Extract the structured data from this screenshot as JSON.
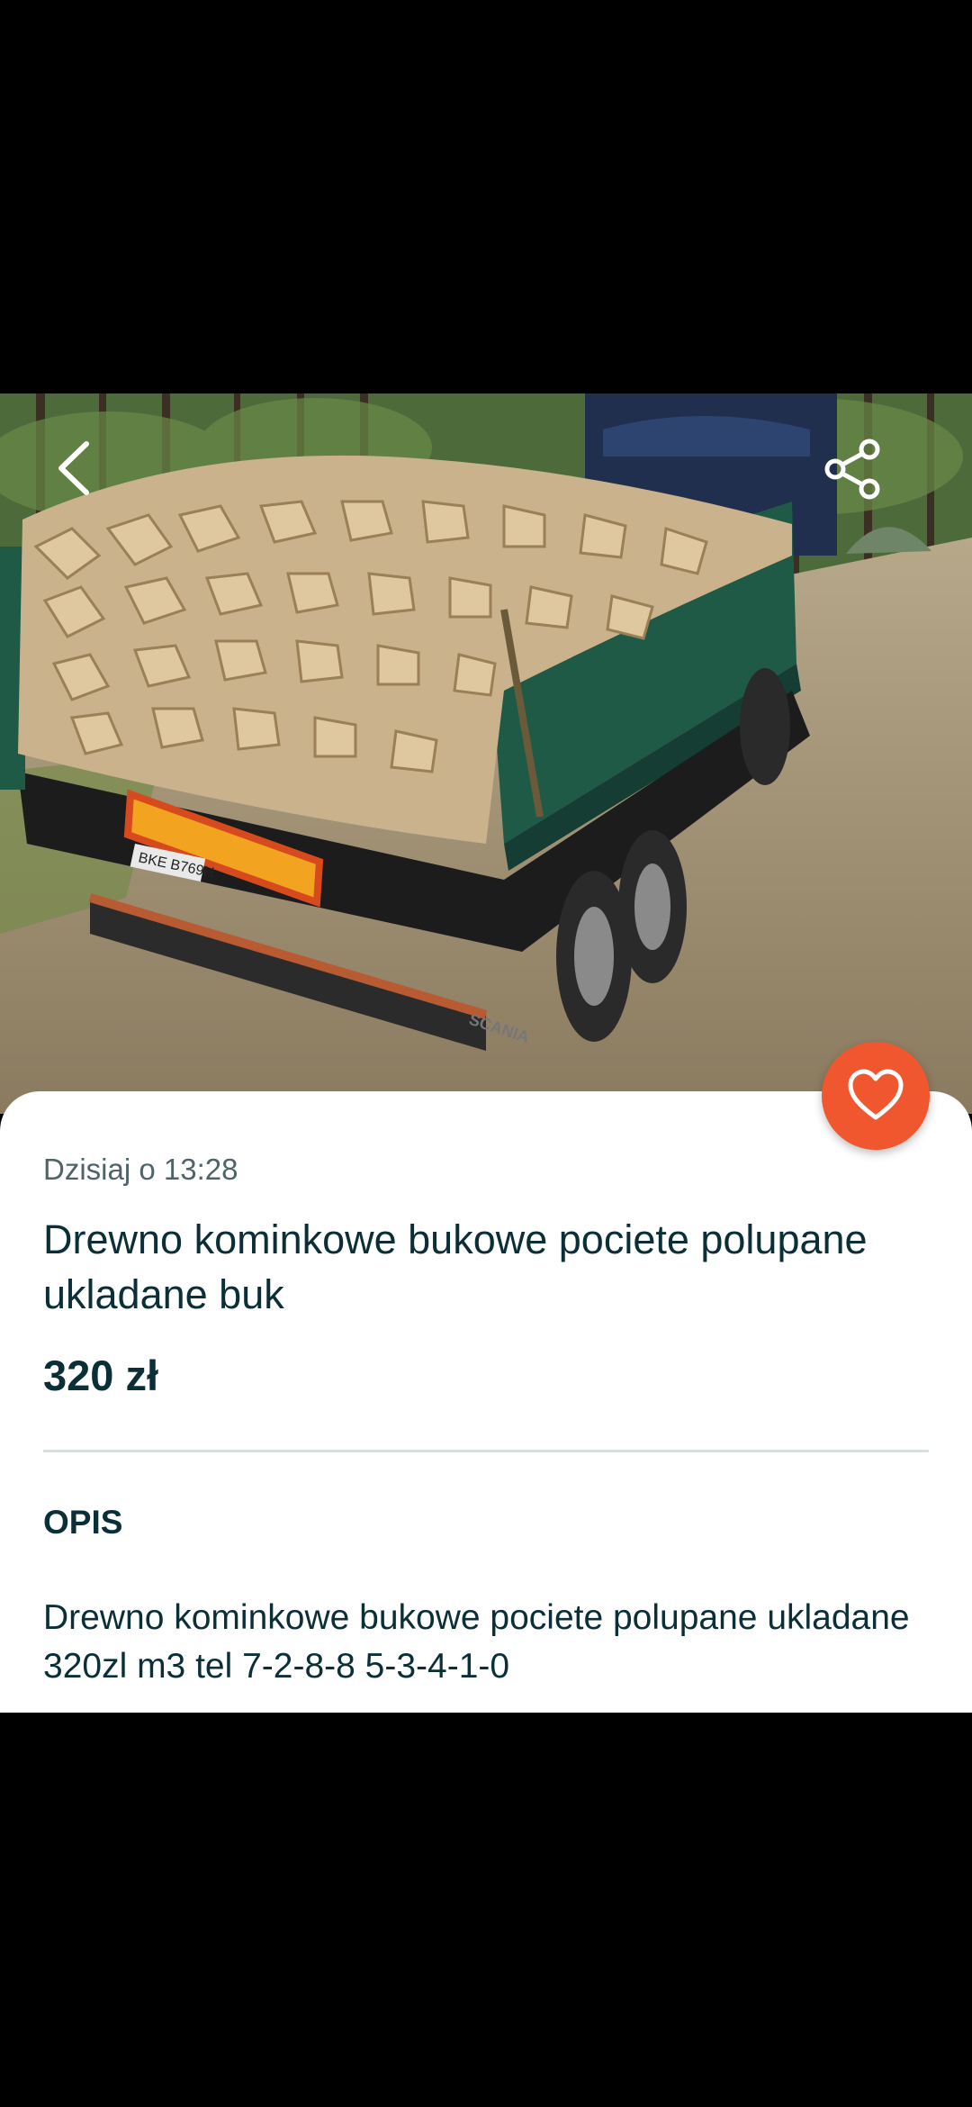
{
  "listing": {
    "date": "Dzisiaj o 13:28",
    "title": "Drewno kominkowe bukowe pociete polupane ukladane buk",
    "price": "320 zł",
    "description_heading": "OPIS",
    "description": "Drewno kominkowe bukowe pociete polupane ukladane 320zl m3 tel 7-2-8-8 5-3-4-1-0"
  },
  "photo": {
    "subject": "truck-loaded-with-firewood",
    "plate_text": "BKE B769H",
    "truck_brand": "SCANIA"
  },
  "icons": {
    "back": "chevron-left-icon",
    "share": "share-icon",
    "favorite": "heart-outline-icon"
  },
  "colors": {
    "accent_favorite": "#f0572f",
    "text_primary": "#0b2f36",
    "text_secondary": "#4f6468",
    "divider": "#d8dfe0"
  }
}
